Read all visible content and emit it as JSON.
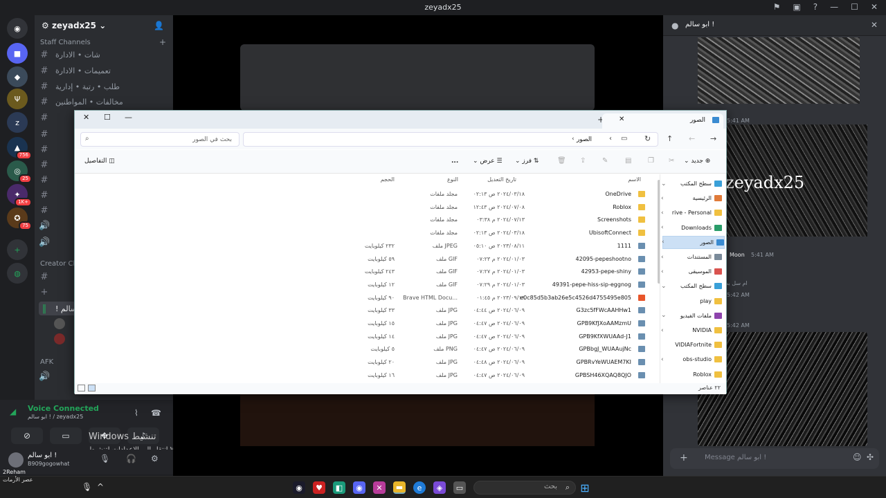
{
  "window_title": "zeyadx25",
  "discord": {
    "guild_name": "zeyadx25",
    "category_staff": "Staff Channels",
    "category_creator": "Creator Cha",
    "category_afk": "AFK",
    "channels": [
      {
        "label": "شات • الادارة",
        "icon": "speech-icon"
      },
      {
        "label": "تعميمات • الادارة",
        "icon": "book-icon"
      },
      {
        "label": "طلب • رتبة • إدارية",
        "icon": "lightbulb-icon"
      },
      {
        "label": "مخالفات • المواطنين",
        "icon": "no-entry-icon"
      }
    ],
    "server_badges": [
      "756",
      "25",
      "1K+",
      "75"
    ],
    "voice_status": "Voice Connected",
    "voice_sub": "ابو سالم ! / zeyadx25",
    "user_name": "ابو سالم !",
    "user_status": "B909gogowhat",
    "username_tag": "2Reham",
    "voice_member": "ابو سالم !",
    "right_panel_title": "ابو سالم !",
    "image_caption": "zeyadx25",
    "time_1": "5:41 AM",
    "moon_name": "Moon",
    "time_2": "5:41 AM",
    "moon_reply": "ام سل بس",
    "time_3": "5:42 AM",
    "time_4": "5:42 AM",
    "message_placeholder": "Message ابو سالم !"
  },
  "windows_watermark": {
    "line1": "Windows تنشيط",
    "line2": "انتقل إلى الإعدادات لتنشيط Windows"
  },
  "taskbar": {
    "search_placeholder": "بحث",
    "notification_text": "عصر الأرمات"
  },
  "explorer": {
    "tab_title": "الصور",
    "search_placeholder": "بحث في الصور",
    "breadcrumb": "الصور",
    "cmd_new": "جديد",
    "cmd_sort": "فرز",
    "cmd_view": "عرض",
    "cmd_more": "...",
    "cmd_details": "التفاصيل",
    "col_name": "الاسم",
    "col_date": "تاريخ التعديل",
    "col_type": "النوع",
    "col_size": "الحجم",
    "nav_items": [
      {
        "label": "سطح المكتب",
        "color": "#3aa0d8",
        "chev": "v"
      },
      {
        "label": "الرئيسية",
        "color": "#e07b39",
        "chev": "<"
      },
      {
        "label": "rive - Personal",
        "color": "#f0c040",
        "chev": "<"
      },
      {
        "label": "Downloads",
        "color": "#2a9d6a",
        "chev": "<"
      },
      {
        "label": "الصور",
        "color": "#3a8bd1",
        "chev": "<",
        "selected": true
      },
      {
        "label": "المستندات",
        "color": "#7a8a99",
        "chev": "<"
      },
      {
        "label": "الموسيقى",
        "color": "#d9534f",
        "chev": "<"
      },
      {
        "label": "سطح المكتب",
        "color": "#3aa0d8",
        "chev": "v"
      },
      {
        "label": "play",
        "color": "#f0c040",
        "chev": ""
      },
      {
        "label": "ملفات الفيديو",
        "color": "#8e44ad",
        "chev": "v"
      },
      {
        "label": "NVIDIA",
        "color": "#f0c040",
        "chev": "<"
      },
      {
        "label": "VIDIAFortnite",
        "color": "#f0c040",
        "chev": ""
      },
      {
        "label": "obs-studio",
        "color": "#f0c040",
        "chev": "<"
      },
      {
        "label": "Roblox",
        "color": "#f0c040",
        "chev": ""
      }
    ],
    "files": [
      {
        "name": "OneDrive",
        "date": "٢٠٢٤/٠٣/١٨ ص ٠٢:١٣",
        "type": "مجلد ملفات",
        "size": "",
        "kind": "folder"
      },
      {
        "name": "Roblox",
        "date": "٢٠٢٤/٠٧/٠٨ ص ١٢:٤٣",
        "type": "مجلد ملفات",
        "size": "",
        "kind": "folder"
      },
      {
        "name": "Screenshots",
        "date": "٢٠٢٤/٠٧/١٣ م ٠٣:٣٨",
        "type": "مجلد ملفات",
        "size": "",
        "kind": "folder"
      },
      {
        "name": "UbisoftConnect",
        "date": "٢٠٢٤/٠٣/١٨ ص ٠٢:١٣",
        "type": "مجلد ملفات",
        "size": "",
        "kind": "folder"
      },
      {
        "name": "1111",
        "date": "٢٠٢٣/٠٨/١١ ص ٠٥:١٠",
        "type": "ملف JPEG",
        "size": "٢٣٢ كيلوبايت",
        "kind": "file"
      },
      {
        "name": "42095-pepeshootno",
        "date": "٢٠٢٤/٠١/٠٣ م ٠٧:٢٣",
        "type": "ملف GIF",
        "size": "٥٩ كيلوبايت",
        "kind": "file"
      },
      {
        "name": "42953-pepe-shiny",
        "date": "٢٠٢٤/٠١/٠٣ م ٠٧:٢٧",
        "type": "ملف GIF",
        "size": "٢٤٣ كيلوبايت",
        "kind": "file"
      },
      {
        "name": "49391-pepe-hiss-sip-eggnog",
        "date": "٢٠٢٤/٠١/٠٣ م ٠٧:٢٩",
        "type": "ملف GIF",
        "size": "١٢ كيلوبايت",
        "kind": "file"
      },
      {
        "name": "e0c85d5b3ab26e5c4526d4755495e805",
        "date": "٢٠٢٣/٠٩/١٩ م ٠١:٤٥",
        "type": "Brave HTML Docu...",
        "size": "٩٠ كيلوبايت",
        "kind": "brave"
      },
      {
        "name": "G3zc5fFWcAAHHw1",
        "date": "٢٠٢٤/٠٦/٠٩ ص ٠٤:٤٤",
        "type": "ملف JPG",
        "size": "٣٣ كيلوبايت",
        "kind": "file"
      },
      {
        "name": "GPB9KfJXoAAMzmU",
        "date": "٢٠٢٤/٠٦/٠٩ ص ٠٤:٤٧",
        "type": "ملف JPG",
        "size": "١٥ كيلوبايت",
        "kind": "file"
      },
      {
        "name": "GPB9KfXWUAAd-J1",
        "date": "٢٠٢٤/٠٦/٠٩ ص ٠٤:٤٧",
        "type": "ملف JPG",
        "size": "١٤ كيلوبايت",
        "kind": "file"
      },
      {
        "name": "GPBbgJ_WUAAujNc",
        "date": "٢٠٢٤/٠٦/٠٩ ص ٠٤:٤٧",
        "type": "ملف PNG",
        "size": "٥ كيلوبايت",
        "kind": "file"
      },
      {
        "name": "GPBRvYeWUAEM7KI",
        "date": "٢٠٢٤/٠٦/٠٩ ص ٠٤:٤٨",
        "type": "ملف JPG",
        "size": "٢٠ كيلوبايت",
        "kind": "file"
      },
      {
        "name": "GPBSH46XQAQ8QJO",
        "date": "٢٠٢٤/٠٦/٠٩ ص ٠٤:٤٧",
        "type": "ملف JPG",
        "size": "١٦ كيلوبايت",
        "kind": "file"
      }
    ],
    "item_count": "٢٢ عناصر"
  }
}
